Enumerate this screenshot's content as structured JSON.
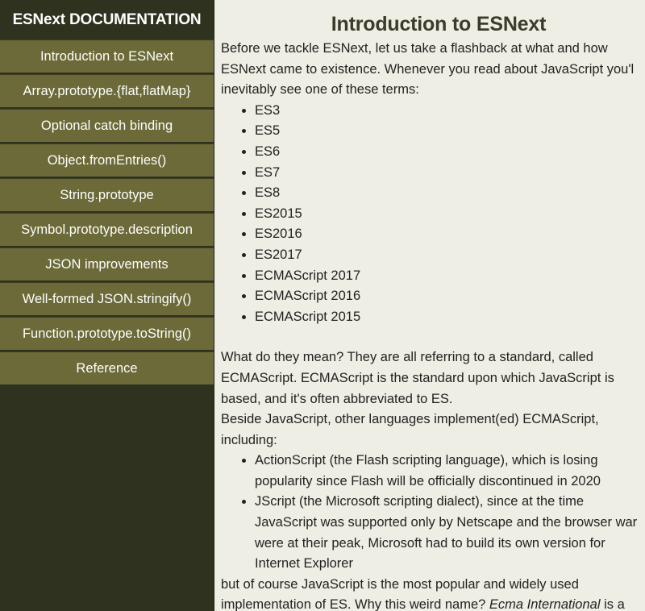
{
  "sidebar": {
    "title": "ESNext DOCUMENTATION",
    "items": [
      {
        "label": "Introduction to ESNext"
      },
      {
        "label": "Array.prototype.{flat,flatMap}"
      },
      {
        "label": "Optional catch binding"
      },
      {
        "label": "Object.fromEntries()"
      },
      {
        "label": "String.prototype"
      },
      {
        "label": "Symbol.prototype.description"
      },
      {
        "label": "JSON improvements"
      },
      {
        "label": "Well-formed JSON.stringify()"
      },
      {
        "label": "Function.prototype.toString()"
      },
      {
        "label": "Reference"
      }
    ]
  },
  "main": {
    "title": "Introduction to ESNext",
    "intro_lines": [
      "Before we tackle ESNext, let us take a flashback at what and how",
      "ESNext came to existence. Whenever you read about JavaScript you'l",
      "inevitably see one of these terms:"
    ],
    "terms": [
      "ES3",
      "ES5",
      "ES6",
      "ES7",
      "ES8",
      "ES2015",
      "ES2016",
      "ES2017",
      "ECMAScript 2017",
      "ECMAScript 2016",
      "ECMAScript 2015"
    ],
    "meaning_lines": [
      "What do they mean? They are all referring to a standard, called",
      "ECMAScript. ECMAScript is the standard upon which JavaScript is",
      "based, and it's often abbreviated to ES."
    ],
    "beside_lines": [
      "Beside JavaScript, other languages implement(ed) ECMAScript,",
      "including:"
    ],
    "implementations": [
      {
        "lines": [
          "ActionScript (the Flash scripting language), which is losing",
          "popularity since Flash will be officially discontinued in 2020"
        ]
      },
      {
        "lines": [
          "JScript (the Microsoft scripting dialect), since at the time",
          "JavaScript was supported only by Netscape and the browser war",
          "were at their peak, Microsoft had to build its own version for",
          "Internet Explorer"
        ]
      }
    ],
    "closing_line_1": "but of course JavaScript is the most popular and widely used",
    "closing_line_2_prefix": "implementation of ES. Why this weird name? ",
    "closing_line_2_em": "Ecma International",
    "closing_line_2_suffix": " is a"
  }
}
